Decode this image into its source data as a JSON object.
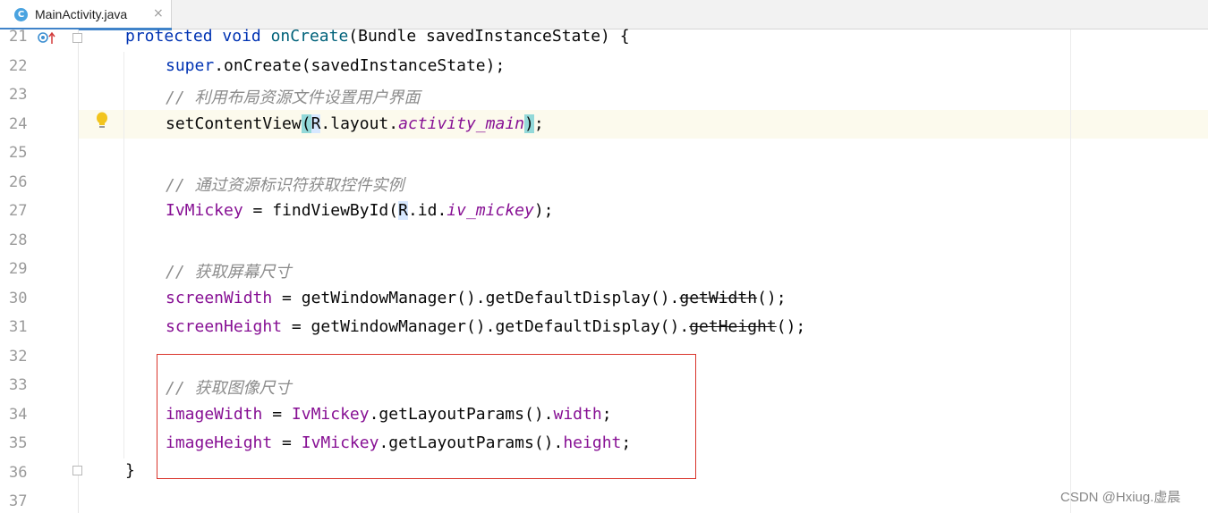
{
  "tab": {
    "label": "MainActivity.java",
    "icon_letter": "C",
    "close": "×"
  },
  "line_numbers": [
    "21",
    "22",
    "23",
    "24",
    "25",
    "26",
    "27",
    "28",
    "29",
    "30",
    "31",
    "32",
    "33",
    "34",
    "35",
    "36",
    "37"
  ],
  "code": {
    "l21": {
      "kw1": "protected",
      "kw2": "void",
      "method": "onCreate",
      "rest": "(Bundle savedInstanceState) {"
    },
    "l22": {
      "kw": "super",
      "rest": ".onCreate(savedInstanceState);"
    },
    "l23": {
      "comment": "// 利用布局资源文件设置用户界面"
    },
    "l24": {
      "pre": "setContentView(",
      "r": "R",
      "mid": ".layout.",
      "ital": "activity_main",
      "post": ");"
    },
    "l26": {
      "comment": "// 通过资源标识符获取控件实例"
    },
    "l27": {
      "field": "IvMickey",
      "mid": " = findViewById(",
      "r": "R",
      "mid2": ".id.",
      "ital": "iv_mickey",
      "post": ");"
    },
    "l29": {
      "comment": "// 获取屏幕尺寸"
    },
    "l30": {
      "field": "screenWidth",
      "mid": " = getWindowManager().getDefaultDisplay().",
      "strike": "getWidth",
      "post": "();"
    },
    "l31": {
      "field": "screenHeight",
      "mid": " = getWindowManager().getDefaultDisplay().",
      "strike": "getHeight",
      "post": "();"
    },
    "l33": {
      "comment": "// 获取图像尺寸"
    },
    "l34": {
      "field": "imageWidth",
      "eq": " = ",
      "field2": "IvMickey",
      "mid": ".getLayoutParams().",
      "field3": "width",
      "post": ";"
    },
    "l35": {
      "field": "imageHeight",
      "eq": " = ",
      "field2": "IvMickey",
      "mid": ".getLayoutParams().",
      "field3": "height",
      "post": ";"
    },
    "l36": {
      "text": "}"
    }
  },
  "watermark": "CSDN @Hxiug.虚晨",
  "colors": {
    "keyword": "#0033b3",
    "field": "#871094",
    "comment": "#8c8c8c",
    "highlight_box": "#d9342b",
    "tab_accent": "#4083c9"
  }
}
